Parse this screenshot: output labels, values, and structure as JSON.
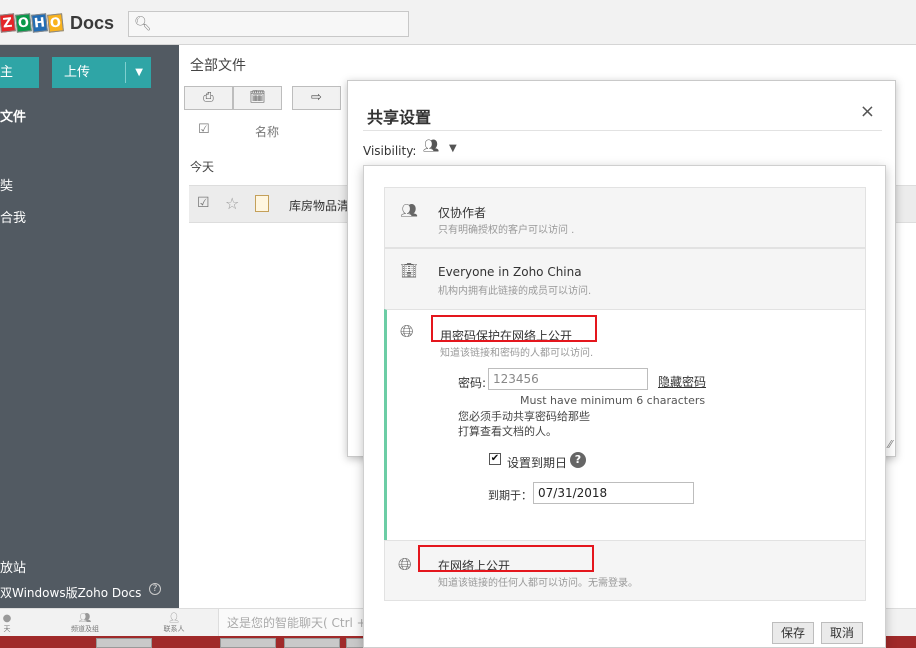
{
  "app": {
    "logo_letters": [
      "Z",
      "O",
      "H",
      "O"
    ],
    "logo_colors": [
      "#e42527",
      "#089949",
      "#226db4",
      "#f9b21d"
    ],
    "product": "Docs",
    "search_icon": "search-icon"
  },
  "sidebar": {
    "new_button": "主",
    "upload_button": "上传",
    "items": [
      "文件",
      "奘",
      "合我"
    ],
    "footer": [
      "放站",
      "双Windows版Zoho Docs"
    ],
    "help_icon": "?"
  },
  "main": {
    "title": "全部文件",
    "toolbar": [
      "⎙",
      "🗓",
      "⇨"
    ],
    "column_name": "名称",
    "group_today": "今天",
    "file_name": "库房物品清"
  },
  "bottom_bar": {
    "items": [
      "天",
      "频道及组",
      "联系人"
    ],
    "chat_placeholder": "这是您的智能聊天( Ctrl +"
  },
  "dialog": {
    "title": "共享设置",
    "close": "×",
    "visibility_label": "Visibility:"
  },
  "options": {
    "collab": {
      "title": "仅协作者",
      "desc": "只有明确授权的客户可以访问 ."
    },
    "org": {
      "title": "Everyone in Zoho China",
      "desc": "机构内拥有此链接的成员可以访问."
    },
    "password": {
      "title": "用密码保护在网络上公开",
      "desc": "知道该链接和密码的人都可以访问.",
      "password_label": "密码:",
      "password_value": "123456",
      "hide_password": "隐藏密码",
      "hint": "Must have minimum 6 characters",
      "note_line1": "您必须手动共享密码给那些",
      "note_line2": "打算查看文档的人。",
      "expiry_label": "设置到期日",
      "expiry_date_label": "到期于：",
      "expiry_date": "07/31/2018"
    },
    "public": {
      "title": "在网络上公开",
      "desc": "知道该链接的任何人都可以访问。无需登录。"
    }
  },
  "footer_buttons": {
    "save": "保存",
    "cancel": "取消"
  },
  "colors": {
    "accent": "#2fa5a6",
    "highlight": "#e4161d",
    "selected_bar": "#6ccda5"
  }
}
